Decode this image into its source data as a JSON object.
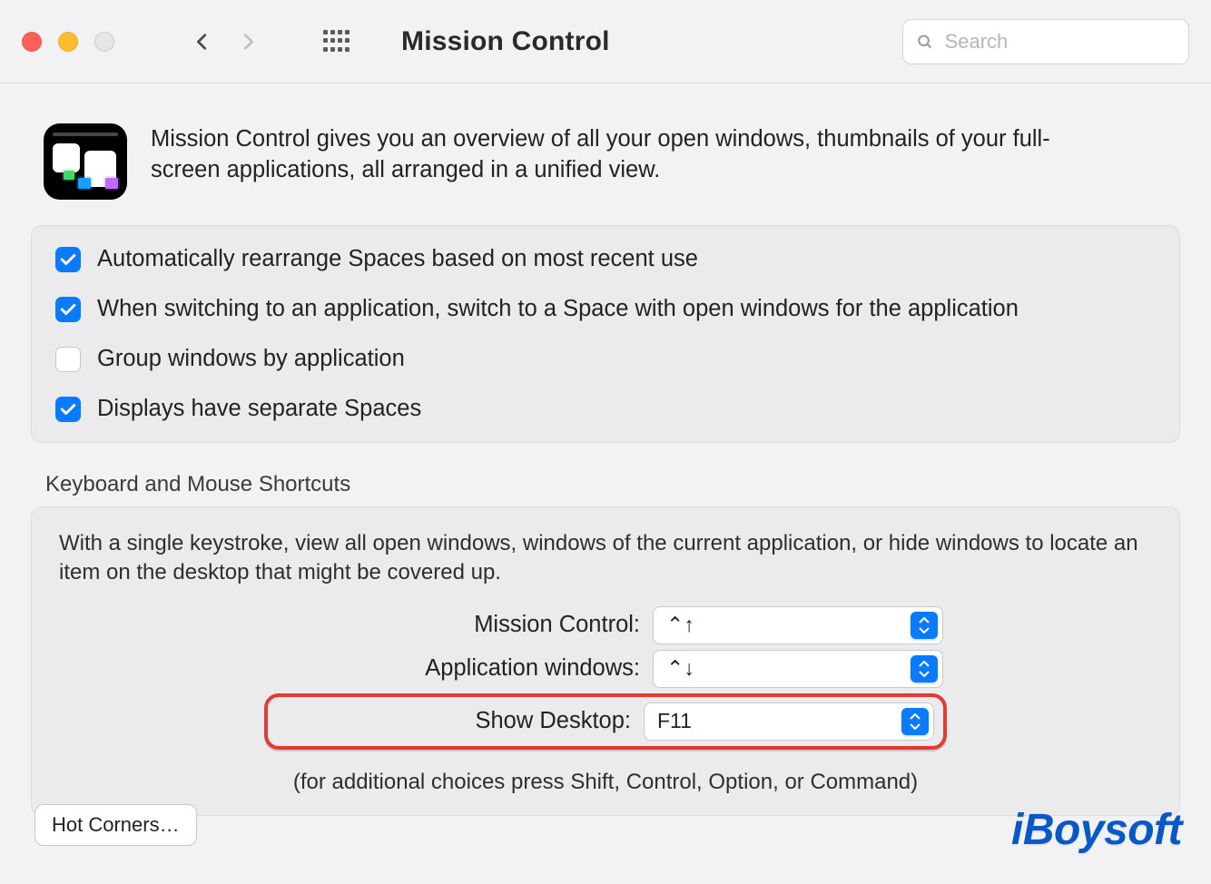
{
  "header": {
    "title": "Mission Control",
    "search_placeholder": "Search"
  },
  "intro": {
    "text": "Mission Control gives you an overview of all your open windows, thumbnails of your full-screen applications, all arranged in a unified view."
  },
  "checkboxes": [
    {
      "label": "Automatically rearrange Spaces based on most recent use",
      "checked": true
    },
    {
      "label": "When switching to an application, switch to a Space with open windows for the application",
      "checked": true
    },
    {
      "label": "Group windows by application",
      "checked": false
    },
    {
      "label": "Displays have separate Spaces",
      "checked": true
    }
  ],
  "shortcuts": {
    "section_title": "Keyboard and Mouse Shortcuts",
    "hint": "With a single keystroke, view all open windows, windows of the current application, or hide windows to locate an item on the desktop that might be covered up.",
    "rows": [
      {
        "label": "Mission Control:",
        "value": "⌃↑"
      },
      {
        "label": "Application windows:",
        "value": "⌃↓"
      },
      {
        "label": "Show Desktop:",
        "value": "F11",
        "highlight": true
      }
    ],
    "footnote": "(for additional choices press Shift, Control, Option, or Command)"
  },
  "hot_corners_label": "Hot Corners…",
  "brand": "iBoysoft"
}
